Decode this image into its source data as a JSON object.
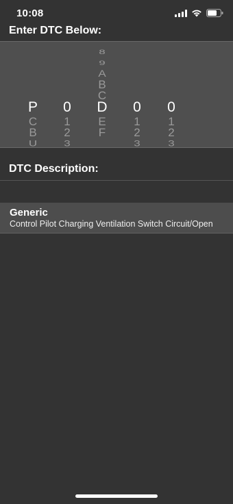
{
  "status_bar": {
    "time": "10:08"
  },
  "entry": {
    "heading": "Enter DTC Below:"
  },
  "picker": {
    "columns": [
      {
        "name": "system",
        "above": [],
        "selected": "P",
        "below": [
          "C",
          "B",
          "U"
        ]
      },
      {
        "name": "digit-1",
        "above": [],
        "selected": "0",
        "below": [
          "1",
          "2",
          "3"
        ]
      },
      {
        "name": "digit-2",
        "above": [
          "8",
          "9",
          "A",
          "B",
          "C"
        ],
        "selected": "D",
        "below": [
          "E",
          "F"
        ]
      },
      {
        "name": "digit-3",
        "above": [],
        "selected": "0",
        "below": [
          "1",
          "2",
          "3"
        ]
      },
      {
        "name": "digit-4",
        "above": [],
        "selected": "0",
        "below": [
          "1",
          "2",
          "3"
        ]
      }
    ]
  },
  "description": {
    "heading": "DTC Description:",
    "result_title": "Generic",
    "result_text": "Control Pilot Charging Ventilation Switch Circuit/Open"
  },
  "colors": {
    "background": "#333333",
    "picker_bg": "#4f4f4f",
    "row_bg": "#4d4d4d"
  }
}
